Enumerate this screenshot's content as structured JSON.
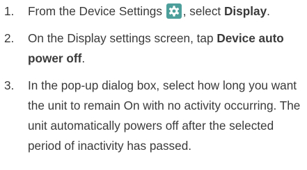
{
  "steps": [
    {
      "number": "1.",
      "text_before": "From the Device Settings",
      "icon": "gear-icon",
      "text_middle": ", select",
      "bold": "Display",
      "text_after": "."
    },
    {
      "number": "2.",
      "text_before": "On the Display settings screen, tap",
      "bold": "Device auto power off",
      "text_after": "."
    },
    {
      "number": "3.",
      "text": "In the pop-up dialog box, select how long you want the unit to remain On with no activity occurring. The unit automatically powers off after the selected period of inactivity has passed."
    }
  ],
  "colors": {
    "text": "#3a3a3a",
    "icon_background": "#4c9f9a",
    "icon_foreground": "#ffffff"
  }
}
